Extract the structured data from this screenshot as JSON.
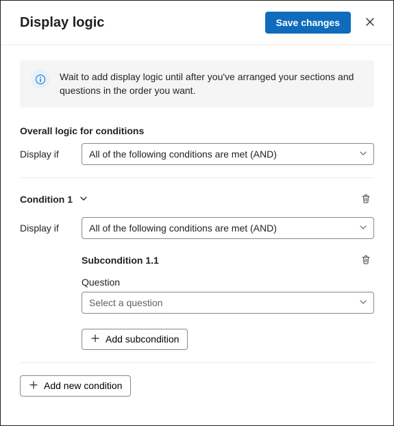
{
  "header": {
    "title": "Display logic",
    "save_label": "Save changes"
  },
  "info": {
    "text": "Wait to add display logic until after you've arranged your sections and questions in the order you want."
  },
  "overall": {
    "section_label": "Overall logic for conditions",
    "display_if_label": "Display if",
    "condition_value": "All of the following conditions are met (AND)"
  },
  "condition1": {
    "title": "Condition 1",
    "display_if_label": "Display if",
    "condition_value": "All of the following conditions are met (AND)",
    "sub": {
      "title": "Subcondition 1.1",
      "question_label": "Question",
      "question_placeholder": "Select a question"
    }
  },
  "buttons": {
    "add_subcondition": "Add subcondition",
    "add_new_condition": "Add new condition"
  },
  "icons": {
    "close": "close-icon",
    "info": "info-icon",
    "chevron_down": "chevron-down-icon",
    "trash": "trash-icon",
    "plus": "plus-icon"
  },
  "colors": {
    "primary": "#0f6cbd",
    "border": "#8a8886",
    "divider": "#edebe9",
    "info_bg": "#f5f5f5",
    "info_icon_bg": "#e6f1fb"
  }
}
